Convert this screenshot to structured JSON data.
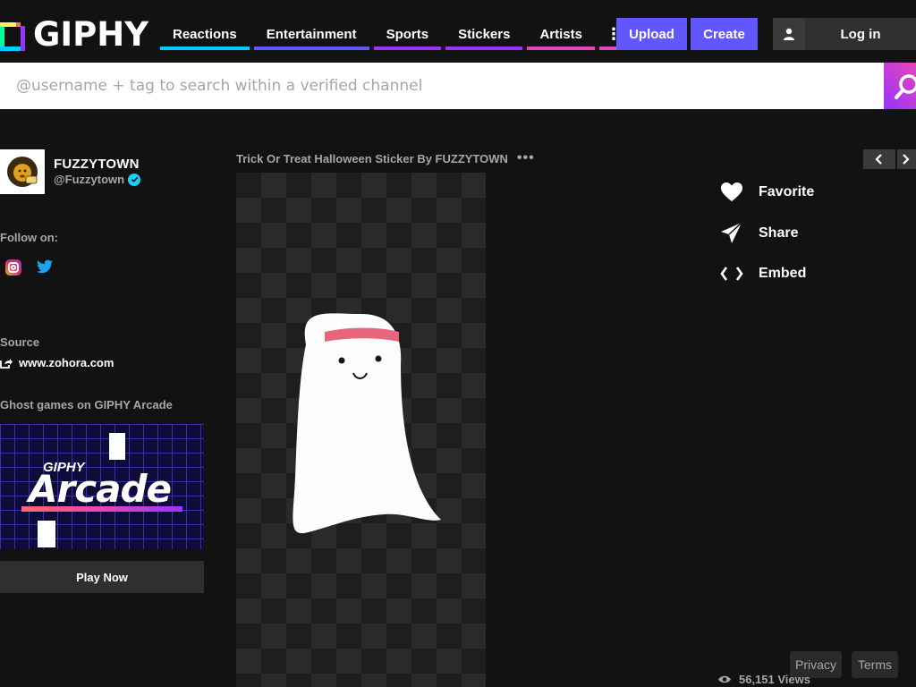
{
  "header": {
    "logo_text": "GIPHY",
    "nav": [
      {
        "label": "Reactions",
        "color": "#00ccff"
      },
      {
        "label": "Entertainment",
        "color": "#6157ff"
      },
      {
        "label": "Sports",
        "color": "#9933ff"
      },
      {
        "label": "Stickers",
        "color": "#9933ff"
      },
      {
        "label": "Artists",
        "color": "#e646b6"
      }
    ],
    "more_label": "⋮",
    "upload_label": "Upload",
    "create_label": "Create",
    "login_label": "Log in"
  },
  "search": {
    "placeholder": "@username + tag to search within a verified channel"
  },
  "channel": {
    "name": "FUZZYTOWN",
    "handle": "@Fuzzytown",
    "follow_label": "Follow on:",
    "source_label": "Source",
    "source_url": "www.zohora.com"
  },
  "arcade": {
    "title": "Ghost games on GIPHY Arcade",
    "giphy_text": "GIPHY",
    "word": "Arcade",
    "play_label": "Play Now"
  },
  "gif": {
    "title": "Trick Or Treat Halloween Sticker By FUZZYTOWN",
    "more": "•••"
  },
  "actions": {
    "favorite": "Favorite",
    "share": "Share",
    "embed": "Embed"
  },
  "footer": {
    "privacy": "Privacy",
    "terms": "Terms",
    "views": "56,151 Views"
  },
  "colors": {
    "accent": "#6157ff",
    "background": "#121212",
    "verified": "#15cffd"
  }
}
